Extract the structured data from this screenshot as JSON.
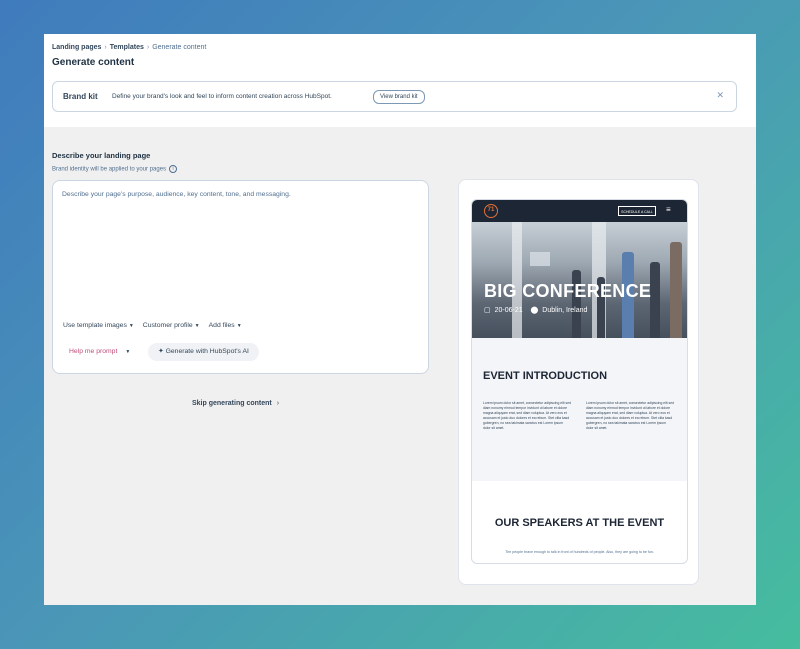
{
  "breadcrumb": {
    "items": [
      "Landing pages",
      "Templates"
    ],
    "current": "Generate content"
  },
  "page_title": "Generate content",
  "brand_kit": {
    "title": "Brand kit",
    "description": "Define your brand's look and feel to inform content creation across HubSpot.",
    "button": "View brand kit",
    "close_icon": "close-icon"
  },
  "describe": {
    "title": "Describe your landing page",
    "subtitle": "Brand identity will be applied to your pages",
    "placeholder": "Describe your page's purpose, audience, key content, tone, and messaging.",
    "options": [
      "Use template images",
      "Customer profile",
      "Add files"
    ],
    "help_label": "Help me prompt",
    "generate_label": "Generate with HubSpot's AI"
  },
  "skip_label": "Skip generating content",
  "preview": {
    "logo_text": "71",
    "nav_button": "SCHEDULE A CALL",
    "hero_title": "BIG CONFERENCE",
    "hero_date": "20-06-21",
    "hero_location": "Dublin, Ireland",
    "section1_title": "EVENT INTRODUCTION",
    "section1_col1": "Lorem ipsum dolor sit amet, consectetur adipiscing elit sed diam nonumy eirmod tempor invidunt ut labore et dolore magna aliquyam erat, sed diam voluptua. At vero eos et accusam et justo duo dolores et ea rebum. Stet clita kasd gubergren, no sea takimata sanctus est Lorem ipsum dolor sit amet.",
    "section1_col2": "Lorem ipsum dolor sit amet, consectetur adipiscing elit sed diam nonumy eirmod tempor invidunt ut labore et dolore magna aliquyam erat, sed diam voluptua. At vero eos et accusam et justo duo dolores et ea rebum. Stet clita kasd gubergren, no sea takimata sanctus est Lorem ipsum dolor sit amet.",
    "section2_title": "OUR SPEAKERS AT THE EVENT",
    "section2_text": "The people brave enough to talk in front of hundreds of people. Also, they are going to be fun."
  },
  "colors": {
    "accent_pink": "#c04d7a",
    "text_dark": "#33475b",
    "nav_dark": "#1d2634",
    "logo_orange": "#e2723a"
  }
}
